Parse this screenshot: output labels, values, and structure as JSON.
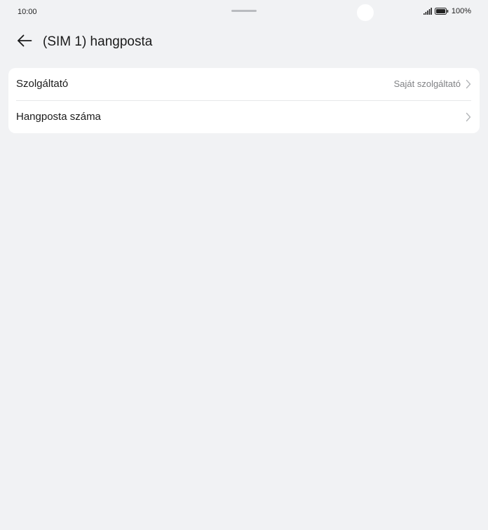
{
  "status_bar": {
    "time": "10:00",
    "battery": "100%",
    "icons": [
      "signal-icon",
      "battery-icon"
    ]
  },
  "header": {
    "back_icon": "arrow-left-icon",
    "title": "(SIM 1) hangposta"
  },
  "settings": {
    "items": [
      {
        "label": "Szolgáltató",
        "value": "Saját szolgáltató",
        "icon": "chevron-right-icon"
      },
      {
        "label": "Hangposta száma",
        "value": "",
        "icon": "chevron-right-icon"
      }
    ]
  },
  "colors": {
    "background": "#f1f2f4",
    "card": "#ffffff",
    "primary_text": "#1a1a1a",
    "secondary_text": "#808285",
    "chevron": "#b4b6b9"
  }
}
